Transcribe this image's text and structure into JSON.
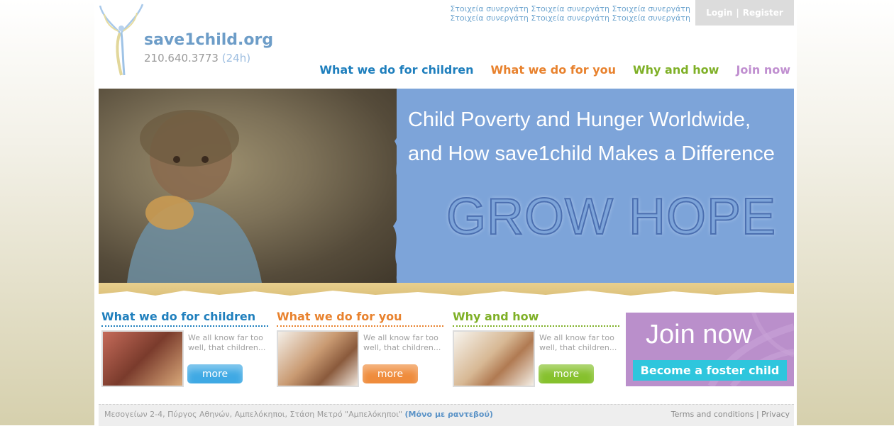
{
  "header": {
    "site_name": "save1child.org",
    "phone": "210.640.3773",
    "phone_hours": "(24h)",
    "partners_line1": "Στοιχεία συνεργάτη Στοιχεία συνεργάτη Στοιχεία συνεργάτη",
    "partners_line2": "Στοιχεία συνεργάτη Στοιχεία συνεργάτη Στοιχεία συνεργάτη",
    "login": "Login",
    "separator": "|",
    "register": "Register"
  },
  "nav": [
    {
      "label": "What we do for children",
      "color": "#1f7fbd"
    },
    {
      "label": "What we do for you",
      "color": "#e8822e"
    },
    {
      "label": "Why and how",
      "color": "#7fb027"
    },
    {
      "label": "Join now",
      "color": "#c08fd0"
    }
  ],
  "hero": {
    "title_line1": "Child Poverty and Hunger Worldwide,",
    "title_line2": "and How save1child Makes a Difference",
    "tagline": "GROW HOPE"
  },
  "sections": [
    {
      "title": "What we do for children",
      "text": "We all know far too well, that children...",
      "more": "more",
      "color": "#1f7fbd",
      "btn_color": "#3fa9e4"
    },
    {
      "title": "What we do for you",
      "text": "We all know far too well, that children...",
      "more": "more",
      "color": "#e8822e",
      "btn_color": "#ef8c3c"
    },
    {
      "title": "Why and how",
      "text": "We all know far too well, that children...",
      "more": "more",
      "color": "#7fb027",
      "btn_color": "#86c12d"
    }
  ],
  "join": {
    "title": "Join now",
    "button": "Become a foster child",
    "color": "#ba8fcb"
  },
  "footer": {
    "address": "Μεσογείων 2-4, Πύργος Αθηνών, Αμπελόκηποι, Στάση Μετρό \"Αμπελόκηποι\"",
    "appointment": "(Μόνο με ραντεβού)",
    "terms": "Terms and conditions",
    "separator": "|",
    "privacy": "Privacy"
  }
}
